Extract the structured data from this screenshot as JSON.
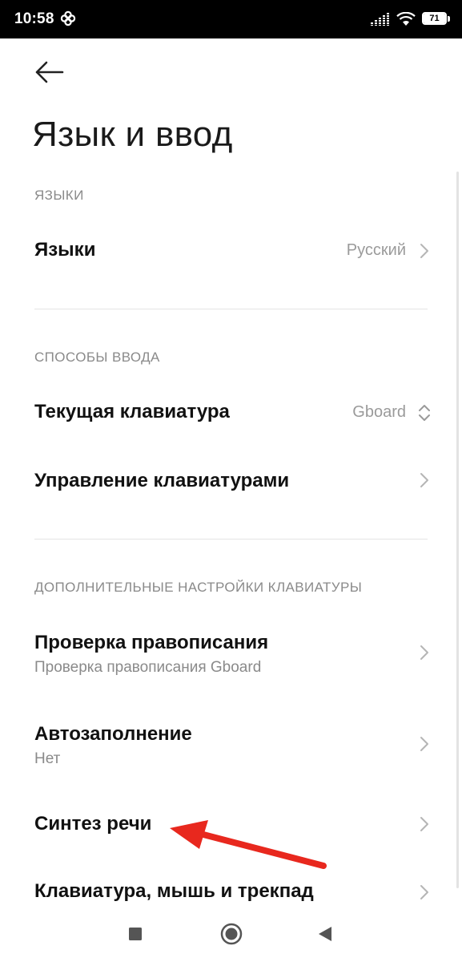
{
  "status_bar": {
    "time": "10:58",
    "battery_level": "71",
    "icons": [
      "pinwheel-app-icon",
      "signal-icon",
      "wifi-icon",
      "battery-icon"
    ]
  },
  "header": {
    "back_icon": "arrow-left-icon",
    "title": "Язык и ввод"
  },
  "sections": {
    "languages": {
      "header": "ЯЗЫКИ",
      "items": [
        {
          "title": "Языки",
          "value": "Русский",
          "control": "chevron-right-icon"
        }
      ]
    },
    "input_methods": {
      "header": "СПОСОБЫ ВВОДА",
      "items": [
        {
          "title": "Текущая клавиатура",
          "value": "Gboard",
          "control": "chevron-up-down-icon"
        },
        {
          "title": "Управление клавиатурами",
          "control": "chevron-right-icon"
        }
      ]
    },
    "keyboard_settings": {
      "header": "ДОПОЛНИТЕЛЬНЫЕ НАСТРОЙКИ КЛАВИАТУРЫ",
      "items": [
        {
          "title": "Проверка правописания",
          "subtitle": "Проверка правописания Gboard",
          "control": "chevron-right-icon"
        },
        {
          "title": "Автозаполнение",
          "subtitle": "Нет",
          "control": "chevron-right-icon"
        },
        {
          "title": "Синтез речи",
          "control": "chevron-right-icon"
        },
        {
          "title": "Клавиатура, мышь и трекпад",
          "control": "chevron-right-icon"
        }
      ]
    }
  },
  "annotation": {
    "type": "red-arrow",
    "color": "#e8281e",
    "points_to": "Синтез речи"
  },
  "nav_bar": {
    "buttons": [
      "recents-square-icon",
      "home-circle-icon",
      "back-triangle-icon"
    ]
  },
  "colors": {
    "status_bar_bg": "#000000",
    "page_bg": "#ffffff",
    "section_header": "#8a8a8a",
    "chevron": "#b5b5b5"
  }
}
